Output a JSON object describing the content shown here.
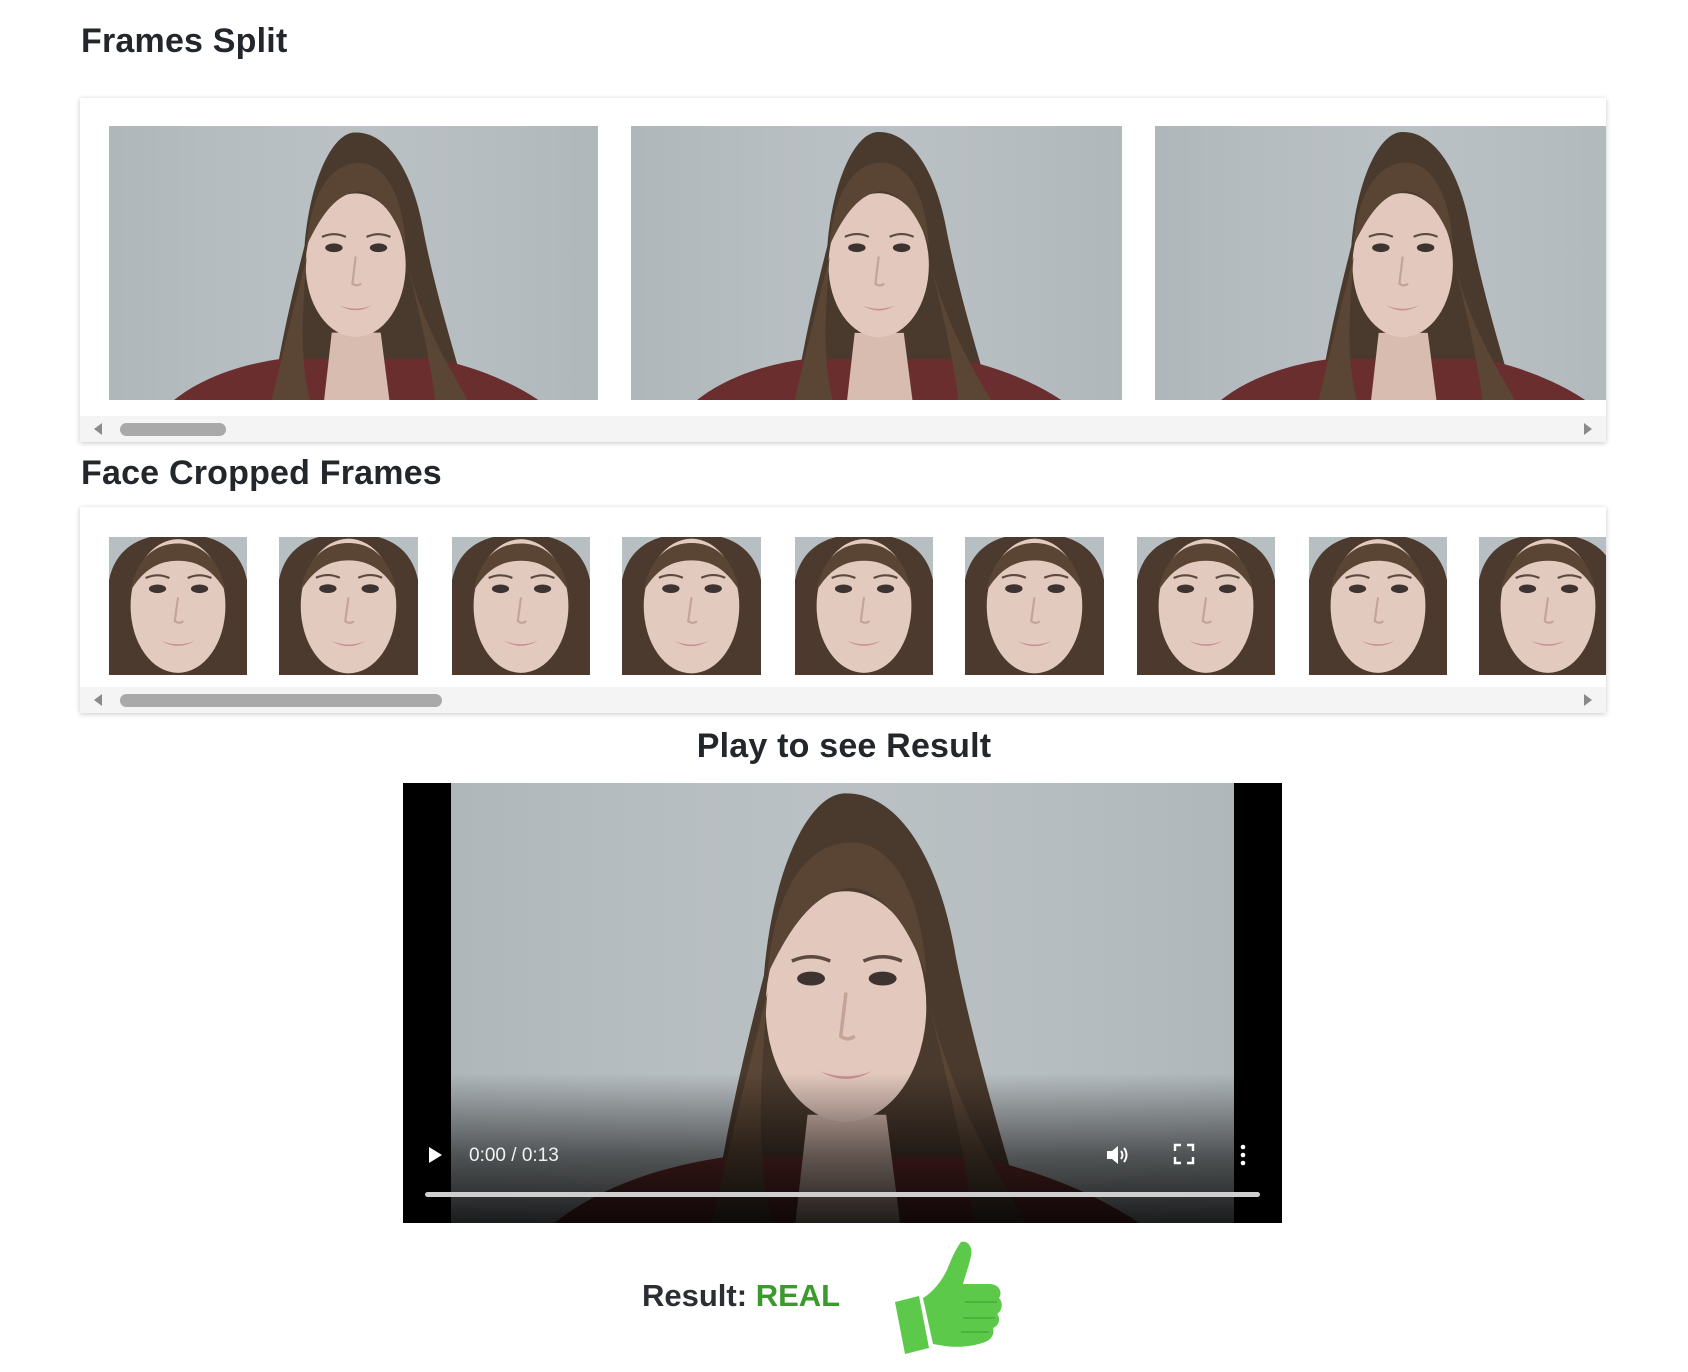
{
  "sections": {
    "frames_split_title": "Frames Split",
    "face_cropped_title": "Face Cropped Frames",
    "play_title": "Play to see Result"
  },
  "frames_split": {
    "visible_count": 3,
    "scroll_position": 0.0
  },
  "face_cropped": {
    "visible_count": 9,
    "scroll_position": 0.0
  },
  "video": {
    "time": "0:00 / 0:13",
    "progress": 0.0,
    "icons": [
      "play-icon",
      "volume-icon",
      "fullscreen-icon",
      "more-options-icon"
    ]
  },
  "result": {
    "label": "Result:",
    "value": "REAL",
    "value_color": "#3a9a2c",
    "icon": "thumbs-up-icon",
    "icon_color": "#5cc94b"
  }
}
